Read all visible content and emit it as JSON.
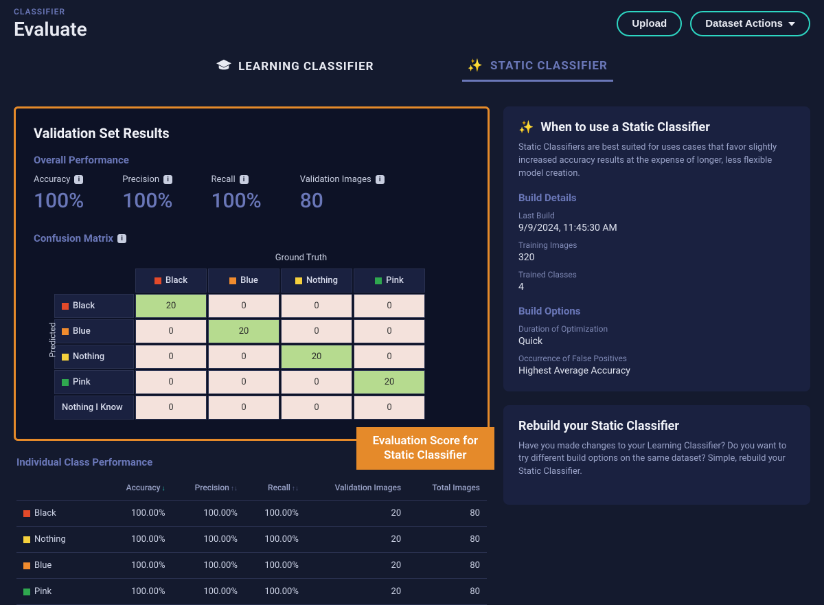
{
  "header": {
    "crumb": "CLASSIFIER",
    "title": "Evaluate",
    "upload_label": "Upload",
    "actions_label": "Dataset Actions"
  },
  "tabs": {
    "learning": "LEARNING CLASSIFIER",
    "static": "STATIC CLASSIFIER"
  },
  "results": {
    "title": "Validation Set Results",
    "overall_label": "Overall Performance",
    "accuracy_label": "Accuracy",
    "precision_label": "Precision",
    "recall_label": "Recall",
    "valimg_label": "Validation Images",
    "accuracy": "100%",
    "precision": "100%",
    "recall": "100%",
    "validation_images": "80",
    "confusion_label": "Confusion Matrix",
    "ground_truth_label": "Ground Truth",
    "predicted_label": "Predicted"
  },
  "classes": [
    "Black",
    "Blue",
    "Nothing",
    "Pink"
  ],
  "extra_row": "Nothing I Know",
  "confusion": {
    "rows": [
      {
        "name": "Black",
        "vals": [
          "20",
          "0",
          "0",
          "0"
        ],
        "diag": 0
      },
      {
        "name": "Blue",
        "vals": [
          "0",
          "20",
          "0",
          "0"
        ],
        "diag": 1
      },
      {
        "name": "Nothing",
        "vals": [
          "0",
          "0",
          "20",
          "0"
        ],
        "diag": 2
      },
      {
        "name": "Pink",
        "vals": [
          "0",
          "0",
          "0",
          "20"
        ],
        "diag": 3
      },
      {
        "name": "Nothing I Know",
        "vals": [
          "0",
          "0",
          "0",
          "0"
        ],
        "diag": -1
      }
    ]
  },
  "callout": {
    "line1": "Evaluation Score for",
    "line2": "Static Classifier"
  },
  "icp": {
    "title": "Individual Class Performance",
    "headers": {
      "accuracy": "Accuracy",
      "precision": "Precision",
      "recall": "Recall",
      "valimg": "Validation Images",
      "total": "Total Images"
    },
    "rows": [
      {
        "name": "Black",
        "swatch": "sw-black",
        "acc": "100.00%",
        "prec": "100.00%",
        "rec": "100.00%",
        "val": "20",
        "tot": "80"
      },
      {
        "name": "Nothing",
        "swatch": "sw-nothing",
        "acc": "100.00%",
        "prec": "100.00%",
        "rec": "100.00%",
        "val": "20",
        "tot": "80"
      },
      {
        "name": "Blue",
        "swatch": "sw-blue",
        "acc": "100.00%",
        "prec": "100.00%",
        "rec": "100.00%",
        "val": "20",
        "tot": "80"
      },
      {
        "name": "Pink",
        "swatch": "sw-pink",
        "acc": "100.00%",
        "prec": "100.00%",
        "rec": "100.00%",
        "val": "20",
        "tot": "80"
      }
    ]
  },
  "side": {
    "when": {
      "title": "When to use a Static Classifier",
      "desc": "Static Classifiers are best suited for uses cases that favor slightly increased accuracy results at the expense of longer, less flexible model creation."
    },
    "build_details_label": "Build Details",
    "last_build_label": "Last Build",
    "last_build_value": "9/9/2024, 11:45:30 AM",
    "training_images_label": "Training Images",
    "training_images_value": "320",
    "trained_classes_label": "Trained Classes",
    "trained_classes_value": "4",
    "build_options_label": "Build Options",
    "duration_label": "Duration of Optimization",
    "duration_value": "Quick",
    "false_pos_label": "Occurrence of False Positives",
    "false_pos_value": "Highest Average Accuracy",
    "rebuild_title": "Rebuild your Static Classifier",
    "rebuild_desc": "Have you made changes to your Learning Classifier? Do you want to try different build options on the same dataset? Simple, rebuild your Static Classifier."
  },
  "colors": {
    "accent": "#2dd6c2",
    "callout": "#e58a2a",
    "subhead": "#6a77b8"
  },
  "chart_data": {
    "type": "table",
    "title": "Confusion Matrix",
    "xlabel": "Ground Truth",
    "ylabel": "Predicted",
    "categories": [
      "Black",
      "Blue",
      "Nothing",
      "Pink"
    ],
    "matrix": [
      [
        20,
        0,
        0,
        0
      ],
      [
        0,
        20,
        0,
        0
      ],
      [
        0,
        0,
        20,
        0
      ],
      [
        0,
        0,
        0,
        20
      ],
      [
        0,
        0,
        0,
        0
      ]
    ],
    "row_labels": [
      "Black",
      "Blue",
      "Nothing",
      "Pink",
      "Nothing I Know"
    ]
  }
}
